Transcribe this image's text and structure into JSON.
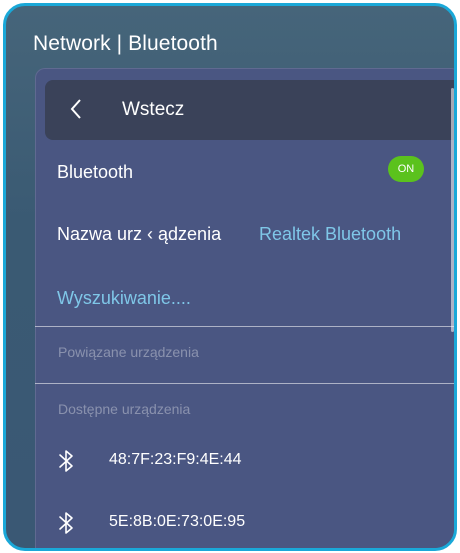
{
  "header": {
    "title": "Network | Bluetooth"
  },
  "back": {
    "label": "Wstecz"
  },
  "bluetooth": {
    "label": "Bluetooth",
    "toggle": "ON"
  },
  "device_name": {
    "label": "Nazwa urz ‹ ądzenia",
    "value": "Realtek Bluetooth"
  },
  "search": {
    "label": "Wyszukiwanie...."
  },
  "sections": {
    "paired": "Powiązane urządzenia",
    "available": "Dostępne urządzenia"
  },
  "devices": [
    {
      "address": "48:7F:23:F9:4E:44",
      "icon": "bluetooth-icon"
    },
    {
      "address": "5E:8B:0E:73:0E:95",
      "icon": "bluetooth-icon"
    }
  ],
  "colors": {
    "accent": "#1aa8d8",
    "toggle_on": "#5bc21d",
    "link": "#7fc7e8",
    "panel": "#4a5682"
  }
}
